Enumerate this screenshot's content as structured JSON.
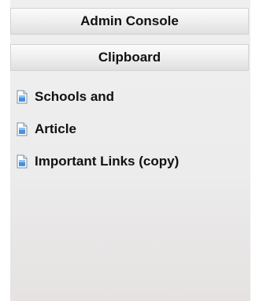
{
  "header": {
    "admin_label": "Admin Console",
    "clipboard_label": "Clipboard"
  },
  "clipboard": {
    "items": [
      {
        "label": "Schools and",
        "icon": "document-icon"
      },
      {
        "label": "Article",
        "icon": "document-icon"
      },
      {
        "label": "Important Links (copy)",
        "icon": "document-icon"
      }
    ]
  },
  "colors": {
    "panel_background": "#ececec",
    "header_border": "#d2d2d2",
    "text": "#111111",
    "icon_blue": "#4a90d9"
  }
}
